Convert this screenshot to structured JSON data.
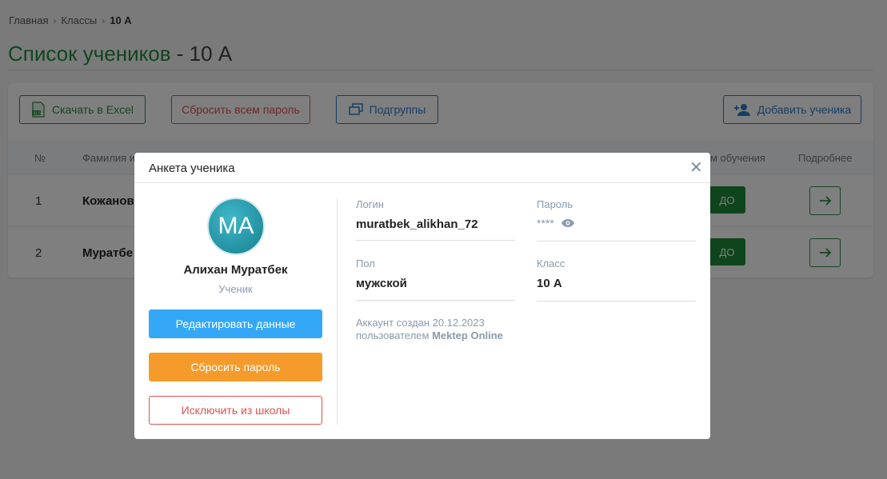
{
  "breadcrumb": {
    "home": "Главная",
    "classes": "Классы",
    "current": "10 А"
  },
  "page": {
    "title": "Список учеников",
    "separator": " - ",
    "group": "10 А"
  },
  "toolbar": {
    "excel_label": "Скачать в Excel",
    "reset_all_label": "Сбросить всем пароль",
    "subgroups_label": "Подгруппы",
    "add_student_label": "Добавить ученика"
  },
  "table": {
    "headers": {
      "num": "№",
      "name": "Фамилия и",
      "mode": "м обучения",
      "details": "Подробнее"
    },
    "rows": [
      {
        "num": "1",
        "name": "Кожанов",
        "badge": "ДО"
      },
      {
        "num": "2",
        "name": "Муратбе",
        "badge": "ДО"
      }
    ]
  },
  "modal": {
    "title": "Анкета ученика",
    "avatar_initials": "MA",
    "name": "Алихан Муратбек",
    "role": "Ученик",
    "edit_label": "Редактировать данные",
    "reset_label": "Сбросить пароль",
    "expel_label": "Исключить из школы",
    "fields": {
      "login_label": "Логин",
      "login_value": "muratbek_alikhan_72",
      "password_label": "Пароль",
      "password_value": "****",
      "gender_label": "Пол",
      "gender_value": "мужской",
      "class_label": "Класс",
      "class_value": "10 А"
    },
    "created_line1": "Аккаунт создан 20.12.2023",
    "created_line2_prefix": "пользователем ",
    "created_by": "Mektep Online"
  },
  "colors": {
    "brand_green": "#1f8a3b",
    "danger_red": "#d9534f",
    "primary_blue": "#2d7ac9",
    "edit_blue": "#35a7f7",
    "reset_orange": "#f59b2b"
  }
}
